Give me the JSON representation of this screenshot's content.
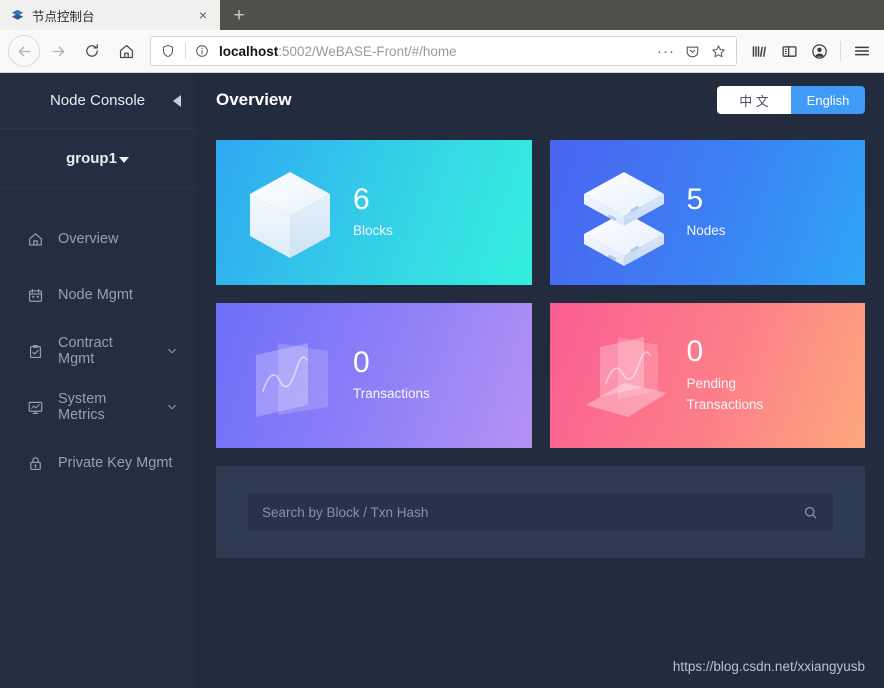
{
  "browser": {
    "tab": {
      "title": "节点控制台",
      "favicon_icon": "layers-favicon",
      "close_icon": "close-icon",
      "close_glyph": "×"
    },
    "newtab": {
      "icon": "plus-icon",
      "glyph": "+"
    },
    "nav": {
      "back_icon": "back-arrow-icon",
      "forward_icon": "forward-arrow-icon",
      "reload_icon": "reload-icon",
      "home_icon": "home-icon"
    },
    "url": {
      "shield_icon": "shield-icon",
      "info_icon": "info-circle-icon",
      "host": "localhost",
      "path": ":5002/WeBASE-Front/#/home",
      "full": "localhost:5002/WeBASE-Front/#/home",
      "more_icon": "ellipsis-icon",
      "more_glyph": "···",
      "pocket_icon": "pocket-icon",
      "bookmark_icon": "star-icon"
    },
    "toolbar": {
      "library_icon": "library-icon",
      "sidebar_icon": "sidebar-icon",
      "account_icon": "account-icon",
      "menu_icon": "hamburger-menu-icon"
    }
  },
  "sidebar": {
    "title": "Node Console",
    "collapse_icon": "collapse-left-icon",
    "group": {
      "label": "group1",
      "caret_icon": "caret-down-icon"
    },
    "items": [
      {
        "label": "Overview",
        "icon": "home-icon",
        "expandable": false
      },
      {
        "label": "Node Mgmt",
        "icon": "calendar-icon",
        "expandable": false
      },
      {
        "label": "Contract Mgmt",
        "icon": "clipboard-check-icon",
        "expandable": true
      },
      {
        "label": "System Metrics",
        "icon": "monitor-chart-icon",
        "expandable": true
      },
      {
        "label": "Private Key Mgmt",
        "icon": "lock-icon",
        "expandable": false
      }
    ]
  },
  "header": {
    "title": "Overview",
    "language": {
      "chinese": "中 文",
      "english": "English",
      "active": "English"
    }
  },
  "cards": [
    {
      "value": "6",
      "label": "Blocks",
      "icon": "cube-icon",
      "gradient_from": "#2fa8f2",
      "gradient_to": "#33e6e0"
    },
    {
      "value": "5",
      "label": "Nodes",
      "icon": "stacked-servers-icon",
      "gradient_from": "#4b63f0",
      "gradient_to": "#2e9bf5"
    },
    {
      "value": "0",
      "label": "Transactions",
      "icon": "chart-card-icon",
      "gradient_from": "#7170f8",
      "gradient_to": "#b18df5"
    },
    {
      "value": "0",
      "label": "Pending Transactions",
      "icon": "pending-chart-icon",
      "gradient_from": "#fb628f",
      "gradient_to": "#fda07e"
    }
  ],
  "search": {
    "placeholder": "Search by Block / Txn Hash",
    "value": "",
    "icon": "search-icon"
  },
  "watermark": "https://blog.csdn.net/xxiangyusb",
  "colors": {
    "sidebar_bg": "#232e42",
    "content_bg": "#222c3e",
    "panel_bg": "#2f3b52",
    "accent_blue": "#3f9bf5"
  }
}
